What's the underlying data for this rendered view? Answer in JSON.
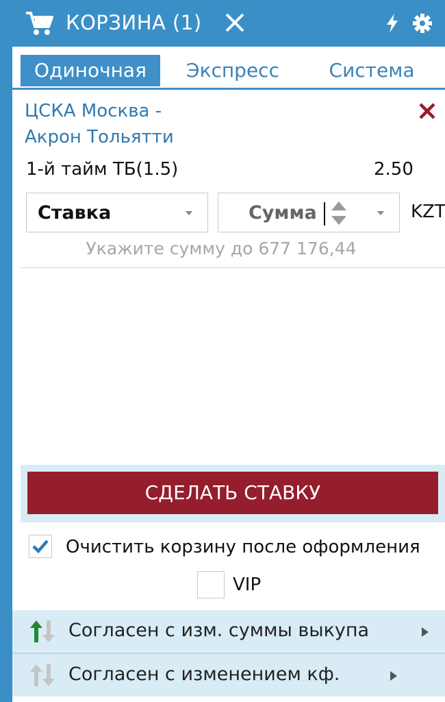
{
  "header": {
    "title": "КОРЗИНА (1)",
    "icons": [
      "cart-icon",
      "close-icon",
      "lightning-icon",
      "gear-icon"
    ]
  },
  "tabs": [
    {
      "label": "Одиночная",
      "active": true
    },
    {
      "label": "Экспресс",
      "active": false
    },
    {
      "label": "Система",
      "active": false
    }
  ],
  "bet": {
    "match_line1": "ЦСКА Москва -",
    "match_line2": "Акрон Тольятти",
    "market": "1-й тайм ТБ(1.5)",
    "odds": "2.50"
  },
  "stake": {
    "select_label": "Ставка",
    "amount_placeholder": "Сумма",
    "currency": "KZT",
    "hint": "Укажите сумму до 677 176,44"
  },
  "actions": {
    "submit_label": "СДЕЛАТЬ СТАВКУ",
    "clear_cart_label": "Очистить корзину после оформления",
    "clear_cart_checked": true,
    "vip_label": "VIP",
    "vip_checked": false
  },
  "options": [
    {
      "label": "Согласен с изм. суммы выкупа"
    },
    {
      "label": "Согласен с изменением кф."
    }
  ],
  "colors": {
    "accent": "#3a8fc7",
    "submit": "#961d2c",
    "remove": "#9b1b2a",
    "options_bg": "#d9ecf6"
  }
}
